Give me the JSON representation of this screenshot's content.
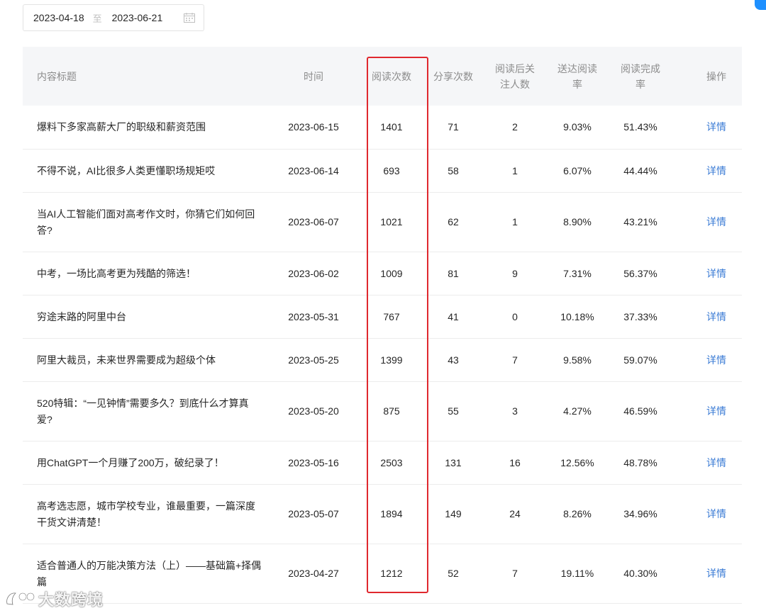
{
  "date_range": {
    "start": "2023-04-18",
    "separator": "至",
    "end": "2023-06-21",
    "icon": "calendar-icon"
  },
  "table": {
    "headers": {
      "title": "内容标题",
      "time": "时间",
      "reads": "阅读次数",
      "shares": "分享次数",
      "follows_line1": "阅读后关",
      "follows_line2": "注人数",
      "delivery_line1": "送达阅读",
      "delivery_line2": "率",
      "completion_line1": "阅读完成",
      "completion_line2": "率",
      "action": "操作"
    },
    "rows": [
      {
        "title": "爆料下多家高薪大厂的职级和薪资范围",
        "date": "2023-06-15",
        "reads": "1401",
        "shares": "71",
        "follows": "2",
        "delivery": "9.03%",
        "completion": "51.43%",
        "action": "详情"
      },
      {
        "title": "不得不说，AI比很多人类更懂职场规矩哎",
        "date": "2023-06-14",
        "reads": "693",
        "shares": "58",
        "follows": "1",
        "delivery": "6.07%",
        "completion": "44.44%",
        "action": "详情"
      },
      {
        "title": "当AI人工智能们面对高考作文时，你猜它们如何回答?",
        "date": "2023-06-07",
        "reads": "1021",
        "shares": "62",
        "follows": "1",
        "delivery": "8.90%",
        "completion": "43.21%",
        "action": "详情"
      },
      {
        "title": "中考，一场比高考更为残酷的筛选！",
        "date": "2023-06-02",
        "reads": "1009",
        "shares": "81",
        "follows": "9",
        "delivery": "7.31%",
        "completion": "56.37%",
        "action": "详情"
      },
      {
        "title": "穷途末路的阿里中台",
        "date": "2023-05-31",
        "reads": "767",
        "shares": "41",
        "follows": "0",
        "delivery": "10.18%",
        "completion": "37.33%",
        "action": "详情"
      },
      {
        "title": "阿里大裁员，未来世界需要成为超级个体",
        "date": "2023-05-25",
        "reads": "1399",
        "shares": "43",
        "follows": "7",
        "delivery": "9.58%",
        "completion": "59.07%",
        "action": "详情"
      },
      {
        "title": "520特辑：“一见钟情”需要多久？到底什么才算真爱?",
        "date": "2023-05-20",
        "reads": "875",
        "shares": "55",
        "follows": "3",
        "delivery": "4.27%",
        "completion": "46.59%",
        "action": "详情"
      },
      {
        "title": "用ChatGPT一个月赚了200万，破纪录了！",
        "date": "2023-05-16",
        "reads": "2503",
        "shares": "131",
        "follows": "16",
        "delivery": "12.56%",
        "completion": "48.78%",
        "action": "详情"
      },
      {
        "title": "高考选志愿，城市学校专业，谁最重要，一篇深度干货文讲清楚！",
        "date": "2023-05-07",
        "reads": "1894",
        "shares": "149",
        "follows": "24",
        "delivery": "8.26%",
        "completion": "34.96%",
        "action": "详情"
      },
      {
        "title": "适合普通人的万能决策方法（上）——基础篇+择偶篇",
        "date": "2023-04-27",
        "reads": "1212",
        "shares": "52",
        "follows": "7",
        "delivery": "19.11%",
        "completion": "40.30%",
        "action": "详情"
      }
    ]
  },
  "watermark": {
    "text": "大数跨境",
    "icon": "brand-logo-icon"
  },
  "colors": {
    "highlight": "#e0282e",
    "link": "#3a7bd5",
    "header_bg": "#f5f6f8",
    "badge": "#1e90ff"
  }
}
